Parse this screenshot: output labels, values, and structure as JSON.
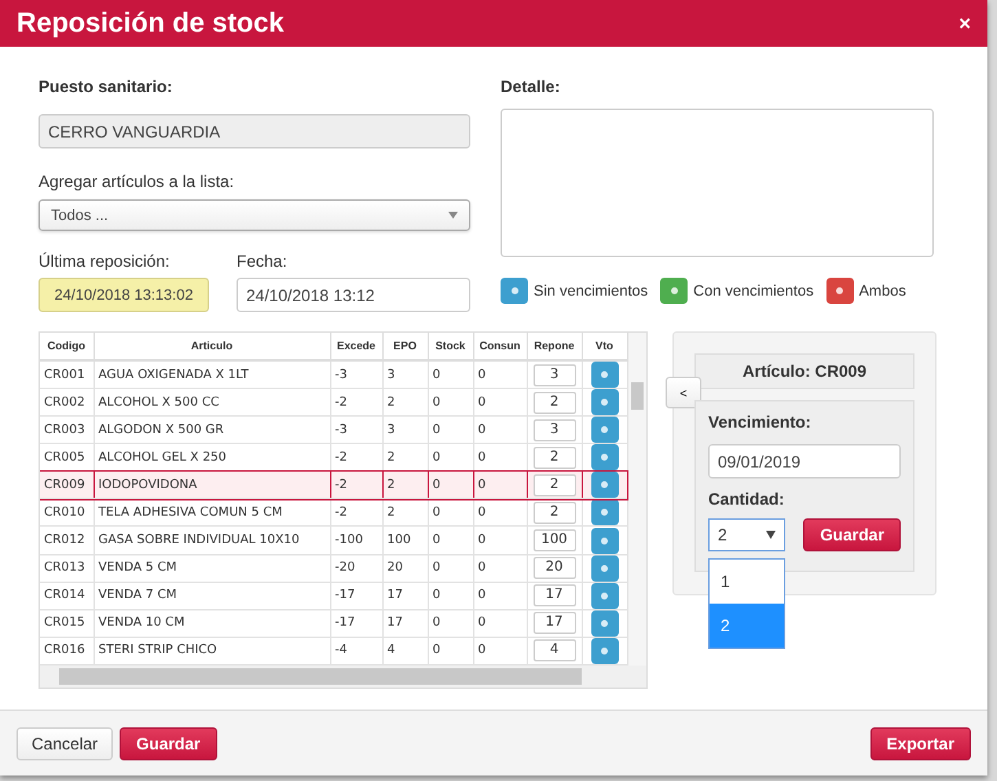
{
  "dialog": {
    "title": "Reposición de stock",
    "close": "×"
  },
  "form": {
    "puesto_label": "Puesto sanitario:",
    "puesto_value": "CERRO VANGUARDIA",
    "agregar_label": "Agregar artículos a la lista:",
    "agregar_value": "Todos ...",
    "ultima_label": "Última reposición:",
    "ultima_value": "24/10/2018 13:13:02",
    "fecha_label": "Fecha:",
    "fecha_value": "24/10/2018 13:12",
    "detalle_label": "Detalle:"
  },
  "legend": [
    {
      "label": "Sin vencimientos",
      "color": "#3d9fcf"
    },
    {
      "label": "Con vencimientos",
      "color": "#4fae4f"
    },
    {
      "label": "Ambos",
      "color": "#d9453f"
    }
  ],
  "table": {
    "columns": [
      "Codigo",
      "Articulo",
      "Excede",
      "EPO",
      "Stock",
      "Consun",
      "Repone",
      "Vto"
    ],
    "rows": [
      {
        "cells": [
          "CR001",
          "AGUA OXIGENADA X 1LT",
          "-3",
          "3",
          "0",
          "0"
        ],
        "repone": "3",
        "selected": false
      },
      {
        "cells": [
          "CR002",
          "ALCOHOL X 500 CC",
          "-2",
          "2",
          "0",
          "0"
        ],
        "repone": "2",
        "selected": false
      },
      {
        "cells": [
          "CR003",
          "ALGODON X 500 GR",
          "-3",
          "3",
          "0",
          "0"
        ],
        "repone": "3",
        "selected": false
      },
      {
        "cells": [
          "CR005",
          "ALCOHOL GEL X 250",
          "-2",
          "2",
          "0",
          "0"
        ],
        "repone": "2",
        "selected": false
      },
      {
        "cells": [
          "CR009",
          "IODOPOVIDONA",
          "-2",
          "2",
          "0",
          "0"
        ],
        "repone": "2",
        "selected": true
      },
      {
        "cells": [
          "CR010",
          "TELA ADHESIVA COMUN 5 CM",
          "-2",
          "2",
          "0",
          "0"
        ],
        "repone": "2",
        "selected": false
      },
      {
        "cells": [
          "CR012",
          "GASA SOBRE INDIVIDUAL 10X10",
          "-100",
          "100",
          "0",
          "0"
        ],
        "repone": "100",
        "selected": false
      },
      {
        "cells": [
          "CR013",
          "VENDA 5 CM",
          "-20",
          "20",
          "0",
          "0"
        ],
        "repone": "20",
        "selected": false
      },
      {
        "cells": [
          "CR014",
          "VENDA 7 CM",
          "-17",
          "17",
          "0",
          "0"
        ],
        "repone": "17",
        "selected": false
      },
      {
        "cells": [
          "CR015",
          "VENDA 10 CM",
          "-17",
          "17",
          "0",
          "0"
        ],
        "repone": "17",
        "selected": false
      },
      {
        "cells": [
          "CR016",
          "STERI STRIP CHICO",
          "-4",
          "4",
          "0",
          "0"
        ],
        "repone": "4",
        "selected": false
      }
    ]
  },
  "side_panel": {
    "toggle": "<",
    "title": "Artículo: CR009",
    "vencimiento_label": "Vencimiento:",
    "vencimiento_value": "09/01/2019",
    "cantidad_label": "Cantidad:",
    "cantidad_value": "2",
    "options": [
      {
        "label": "1",
        "selected": false
      },
      {
        "label": "2",
        "selected": true
      }
    ],
    "save": "Guardar"
  },
  "footer": {
    "cancel": "Cancelar",
    "save": "Guardar",
    "export": "Exportar"
  }
}
